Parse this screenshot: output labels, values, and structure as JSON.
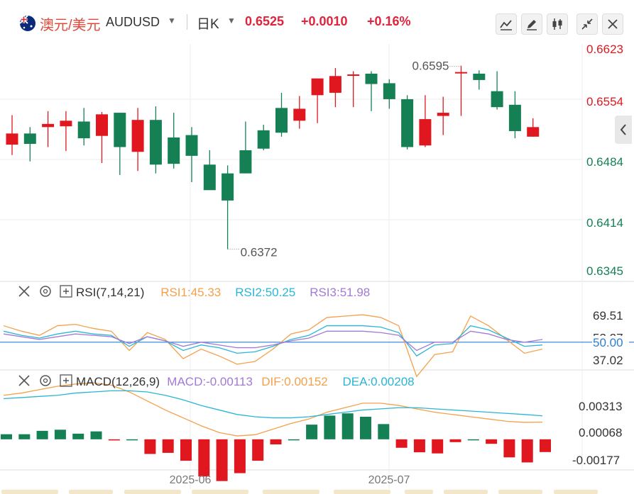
{
  "header": {
    "pair_cn": "澳元/美元",
    "pair_code": "AUDUSD",
    "period": "日K",
    "price": "0.6525",
    "change": "+0.0010",
    "change_pct": "+0.16%",
    "flag_icon": "australia-flag-icon",
    "buttons": [
      "draw-line-icon",
      "pencil-icon",
      "candles-icon",
      "collapse-icon",
      "close-icon"
    ]
  },
  "colors": {
    "up": "#e0171e",
    "down": "#168055",
    "grid": "#eeeeee",
    "rsi1": "#f5a04a",
    "rsi2": "#29b6d6",
    "rsi3": "#a27ad6",
    "macd": "#a27ad6",
    "dif": "#f5a04a",
    "dea": "#29b6d6",
    "ref_line": "#2c7fd6"
  },
  "chart_data": [
    {
      "type": "candlestick",
      "title": "AUDUSD 日K",
      "x_labels": [
        "2025-06",
        "2025-07"
      ],
      "y_ticks": [
        "0.6623",
        "0.6554",
        "0.6484",
        "0.6414",
        "0.6345"
      ],
      "annotations": {
        "high": "0.6595",
        "low": "0.6372"
      },
      "candles": [
        {
          "o": 0.6503,
          "h": 0.654,
          "l": 0.649,
          "c": 0.6517
        },
        {
          "o": 0.6517,
          "h": 0.6525,
          "l": 0.6482,
          "c": 0.6504
        },
        {
          "o": 0.6525,
          "h": 0.6545,
          "l": 0.65,
          "c": 0.6529
        },
        {
          "o": 0.6526,
          "h": 0.6545,
          "l": 0.6495,
          "c": 0.6533
        },
        {
          "o": 0.6532,
          "h": 0.6549,
          "l": 0.6502,
          "c": 0.6511
        },
        {
          "o": 0.6514,
          "h": 0.6544,
          "l": 0.648,
          "c": 0.6541
        },
        {
          "o": 0.6543,
          "h": 0.6543,
          "l": 0.6465,
          "c": 0.65
        },
        {
          "o": 0.6494,
          "h": 0.6549,
          "l": 0.647,
          "c": 0.6534
        },
        {
          "o": 0.6534,
          "h": 0.6551,
          "l": 0.6467,
          "c": 0.6478
        },
        {
          "o": 0.6512,
          "h": 0.6543,
          "l": 0.6473,
          "c": 0.6479
        },
        {
          "o": 0.6515,
          "h": 0.6525,
          "l": 0.6456,
          "c": 0.6489
        },
        {
          "o": 0.6478,
          "h": 0.6496,
          "l": 0.6455,
          "c": 0.6446
        },
        {
          "o": 0.6467,
          "h": 0.6477,
          "l": 0.6372,
          "c": 0.6433
        },
        {
          "o": 0.6496,
          "h": 0.6532,
          "l": 0.6467,
          "c": 0.6467
        },
        {
          "o": 0.6521,
          "h": 0.6528,
          "l": 0.6496,
          "c": 0.6498
        },
        {
          "o": 0.6549,
          "h": 0.6568,
          "l": 0.6513,
          "c": 0.6518
        },
        {
          "o": 0.6533,
          "h": 0.6564,
          "l": 0.6523,
          "c": 0.6548
        },
        {
          "o": 0.6565,
          "h": 0.6582,
          "l": 0.653,
          "c": 0.6586
        },
        {
          "o": 0.6568,
          "h": 0.6599,
          "l": 0.655,
          "c": 0.6589
        },
        {
          "o": 0.659,
          "h": 0.6595,
          "l": 0.655,
          "c": 0.6591
        },
        {
          "o": 0.6592,
          "h": 0.6595,
          "l": 0.6545,
          "c": 0.6579
        },
        {
          "o": 0.658,
          "h": 0.6585,
          "l": 0.6548,
          "c": 0.656
        },
        {
          "o": 0.656,
          "h": 0.6565,
          "l": 0.6497,
          "c": 0.65
        },
        {
          "o": 0.6502,
          "h": 0.6565,
          "l": 0.65,
          "c": 0.6535
        },
        {
          "o": 0.6539,
          "h": 0.6563,
          "l": 0.6515,
          "c": 0.6543
        },
        {
          "o": 0.6594,
          "h": 0.6602,
          "l": 0.6539,
          "c": 0.6594
        },
        {
          "o": 0.6592,
          "h": 0.6596,
          "l": 0.6572,
          "c": 0.6584
        },
        {
          "o": 0.657,
          "h": 0.6595,
          "l": 0.6547,
          "c": 0.655
        },
        {
          "o": 0.6553,
          "h": 0.657,
          "l": 0.6511,
          "c": 0.652
        },
        {
          "o": 0.6513,
          "h": 0.6536,
          "l": 0.6513,
          "c": 0.6525
        }
      ]
    },
    {
      "type": "line",
      "name": "RSI",
      "label": "RSI(7,14,21)",
      "legend": [
        "RSI1:45.33",
        "RSI2:50.25",
        "RSI3:51.98"
      ],
      "y_ticks": [
        "69.51",
        "53.27",
        "50.00",
        "37.02"
      ],
      "ref_line": 50,
      "series": [
        {
          "name": "RSI1",
          "values": [
            62,
            58,
            55,
            62,
            63,
            60,
            58,
            44,
            57,
            52,
            38,
            45,
            40,
            34,
            36,
            45,
            56,
            59,
            68,
            69,
            70,
            68,
            62,
            25,
            41,
            43,
            69,
            62,
            52,
            42,
            45
          ]
        },
        {
          "name": "RSI2",
          "values": [
            58,
            55,
            53,
            56,
            58,
            56,
            55,
            47,
            54,
            51,
            44,
            48,
            46,
            42,
            43,
            47,
            52,
            55,
            62,
            62,
            62,
            61,
            57,
            40,
            48,
            49,
            62,
            59,
            53,
            47,
            48
          ]
        },
        {
          "name": "RSI3",
          "values": [
            56,
            54,
            52,
            54,
            56,
            55,
            54,
            49,
            54,
            51,
            47,
            50,
            48,
            46,
            46,
            48,
            51,
            53,
            58,
            58,
            58,
            57,
            55,
            44,
            50,
            50,
            58,
            56,
            52,
            50,
            52
          ]
        }
      ]
    },
    {
      "type": "bar+line",
      "name": "MACD",
      "label": "MACD(12,26,9)",
      "legend": [
        "MACD:-0.00113",
        "DIF:0.00152",
        "DEA:0.00208"
      ],
      "y_ticks": [
        "0.00313",
        "0.00068",
        "-0.00177"
      ],
      "macd": [
        0.00045,
        0.00045,
        0.00075,
        0.00085,
        0.0005,
        0.0007,
        -0.0001,
        0.0,
        -0.0013,
        -0.0012,
        -0.0019,
        -0.0033,
        -0.0037,
        -0.003,
        -0.0019,
        -0.00045,
        0.0,
        0.0013,
        0.0021,
        0.0023,
        0.002,
        0.00135,
        -0.00075,
        -0.00115,
        -0.00125,
        -0.00025,
        0.0,
        -0.0004,
        -0.0016,
        -0.00205,
        -0.00113
      ],
      "dif": [
        0.0039,
        0.0041,
        0.0044,
        0.0047,
        0.0049,
        0.005,
        0.0048,
        0.0042,
        0.0034,
        0.0026,
        0.0019,
        0.0012,
        0.0006,
        0.0003,
        0.0004,
        0.0009,
        0.0014,
        0.0018,
        0.0024,
        0.0028,
        0.0032,
        0.0032,
        0.003,
        0.0027,
        0.0024,
        0.0022,
        0.002,
        0.0018,
        0.0016,
        0.0015,
        0.00152
      ],
      "dea": [
        0.0036,
        0.0037,
        0.0038,
        0.0039,
        0.0041,
        0.0042,
        0.0043,
        0.0043,
        0.0042,
        0.0039,
        0.0035,
        0.003,
        0.0026,
        0.0022,
        0.002,
        0.0019,
        0.0019,
        0.002,
        0.0022,
        0.0024,
        0.0026,
        0.0027,
        0.0028,
        0.0028,
        0.0027,
        0.0026,
        0.0025,
        0.0024,
        0.0023,
        0.0022,
        0.00208
      ]
    }
  ]
}
